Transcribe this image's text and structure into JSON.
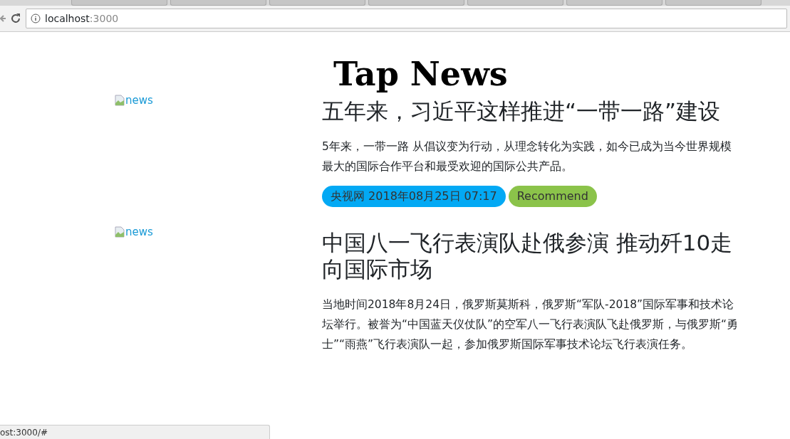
{
  "browser": {
    "address_host": "localhost",
    "address_port": ":3000",
    "status_url": "ost:3000/#"
  },
  "logo": "Tap News",
  "articles": [
    {
      "image_alt": "news",
      "title": "五年来，习近平这样推进“一带一路”建设",
      "description": "5年来，一带一路 从倡议变为行动，从理念转化为实践，如今已成为当今世界规模最大的国际合作平台和最受欢迎的国际公共产品。",
      "badges": [
        {
          "text": "央视网 2018年08月25日 07:17",
          "color": "#03a9f4"
        },
        {
          "text": "Recommend",
          "color": "#8bc34a"
        }
      ]
    },
    {
      "image_alt": "news",
      "title": "中国八一飞行表演队赴俄参演 推动歼10走向国际市场",
      "description": "当地时间2018年8月24日，俄罗斯莫斯科，俄罗斯“军队-2018”国际军事和技术论坛举行。被誉为“中国蓝天仪仗队”的空军八一飞行表演队飞赴俄罗斯，与俄罗斯“勇士”“雨燕”飞行表演队一起，参加俄罗斯国际军事技术论坛飞行表演任务。"
    }
  ]
}
